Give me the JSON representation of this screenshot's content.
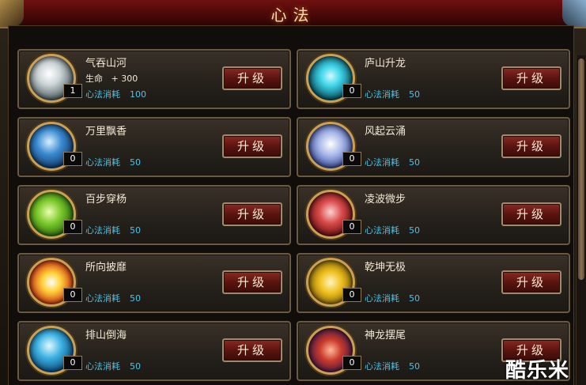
{
  "window": {
    "title": "心法"
  },
  "upgrade_label": "升级",
  "cost_label": "心法消耗",
  "skills": [
    {
      "name": "气吞山河",
      "level": "1",
      "effect_label": "生命",
      "effect_value": "+ 300",
      "cost": "100"
    },
    {
      "name": "庐山升龙",
      "level": "0",
      "cost": "50"
    },
    {
      "name": "万里飘香",
      "level": "0",
      "cost": "50"
    },
    {
      "name": "风起云涌",
      "level": "0",
      "cost": "50"
    },
    {
      "name": "百步穿杨",
      "level": "0",
      "cost": "50"
    },
    {
      "name": "凌波微步",
      "level": "0",
      "cost": "50"
    },
    {
      "name": "所向披靡",
      "level": "0",
      "cost": "50"
    },
    {
      "name": "乾坤无极",
      "level": "0",
      "cost": "50"
    },
    {
      "name": "排山倒海",
      "level": "0",
      "cost": "50"
    },
    {
      "name": "神龙摆尾",
      "level": "0",
      "cost": "50"
    }
  ],
  "watermark": "酷乐米"
}
